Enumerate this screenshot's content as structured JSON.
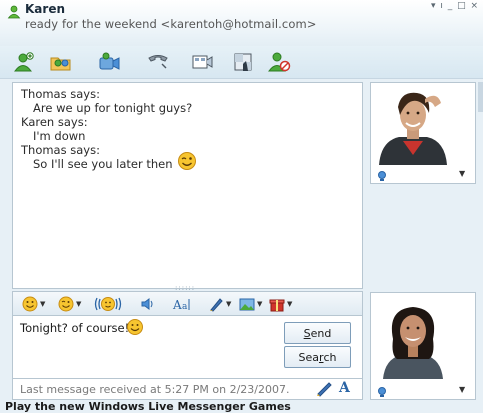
{
  "header": {
    "contact_name": "Karen",
    "contact_status": "ready for the weekend <karentoh@hotmail.com>",
    "window_controls": "▾ ı _ □ ×"
  },
  "toolbar": {
    "items": [
      "invite-contact",
      "share-files",
      "video-call",
      "call",
      "activities",
      "games",
      "block-contact"
    ]
  },
  "conversation": {
    "lines": [
      {
        "speaker": "Thomas says:",
        "text": "Are we up for tonight guys?"
      },
      {
        "speaker": "Karen says:",
        "text": "I'm down"
      },
      {
        "speaker": "Thomas says:",
        "text": "So I'll see you later then",
        "emoticon": "wink"
      }
    ],
    "grip": "::::::"
  },
  "format_bar": {
    "items": [
      "emoticons",
      "winks",
      "nudge",
      "voice-clip",
      "font",
      "handwriting",
      "backgrounds",
      "gifts"
    ],
    "font_label": "A"
  },
  "compose": {
    "text": "Tonight? of course!",
    "send_label_pre": "",
    "send_label_u": "S",
    "send_label_post": "end",
    "search_label_pre": "Sea",
    "search_label_u": "r",
    "search_label_post": "ch"
  },
  "status": {
    "last_message": "Last message received at 5:27 PM on 2/23/2007."
  },
  "footer": {
    "games_link": "Play the new Windows Live Messenger Games"
  },
  "colors": {
    "accent": "#3a79b8",
    "header_bg": "#eef5f9",
    "emoticon_yellow": "#f7c530"
  }
}
